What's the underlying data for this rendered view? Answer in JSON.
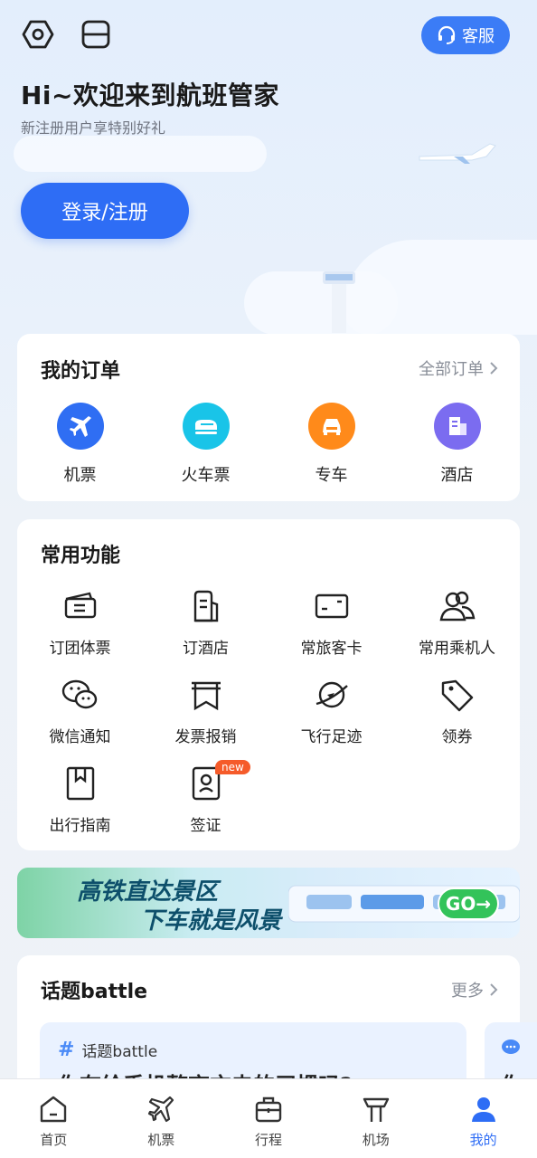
{
  "header": {
    "service_label": "客服",
    "title": "Hi~欢迎来到航班管家",
    "subtitle": "新注册用户享特别好礼",
    "login_label": "登录/注册"
  },
  "orders": {
    "title": "我的订单",
    "more": "全部订单",
    "items": [
      {
        "label": "机票",
        "icon": "plane-icon",
        "color": "#2f6ef3"
      },
      {
        "label": "火车票",
        "icon": "train-icon",
        "color": "#19c4e8"
      },
      {
        "label": "专车",
        "icon": "car-icon",
        "color": "#ff8a1a"
      },
      {
        "label": "酒店",
        "icon": "hotel-icon",
        "color": "#7b6cf0"
      }
    ]
  },
  "functions": {
    "title": "常用功能",
    "items": [
      {
        "label": "订团体票",
        "icon": "group-ticket-icon"
      },
      {
        "label": "订酒店",
        "icon": "hotel-building-icon"
      },
      {
        "label": "常旅客卡",
        "icon": "member-card-icon"
      },
      {
        "label": "常用乘机人",
        "icon": "passengers-icon"
      },
      {
        "label": "微信通知",
        "icon": "wechat-icon"
      },
      {
        "label": "发票报销",
        "icon": "invoice-icon"
      },
      {
        "label": "飞行足迹",
        "icon": "planet-icon"
      },
      {
        "label": "领券",
        "icon": "coupon-tag-icon"
      },
      {
        "label": "出行指南",
        "icon": "guide-book-icon"
      },
      {
        "label": "签证",
        "icon": "visa-icon",
        "badge": "new"
      }
    ]
  },
  "banner": {
    "line1": "高铁直达景区",
    "line2": "下车就是风景",
    "cta": "GO→"
  },
  "topics": {
    "title": "话题battle",
    "more": "更多",
    "card_tag": "话题battle",
    "card_question": "你有给手机整夜充电的习惯吗?",
    "card2_question": "你"
  },
  "tabbar": {
    "items": [
      {
        "label": "首页",
        "icon": "home-icon",
        "active": false
      },
      {
        "label": "机票",
        "icon": "plane-icon",
        "active": false
      },
      {
        "label": "行程",
        "icon": "suitcase-icon",
        "active": false
      },
      {
        "label": "机场",
        "icon": "airport-tower-icon",
        "active": false
      },
      {
        "label": "我的",
        "icon": "user-icon",
        "active": true
      }
    ]
  },
  "colors": {
    "accent": "#2e6df5",
    "badge": "#f55b2a",
    "go_button": "#33c35a"
  }
}
